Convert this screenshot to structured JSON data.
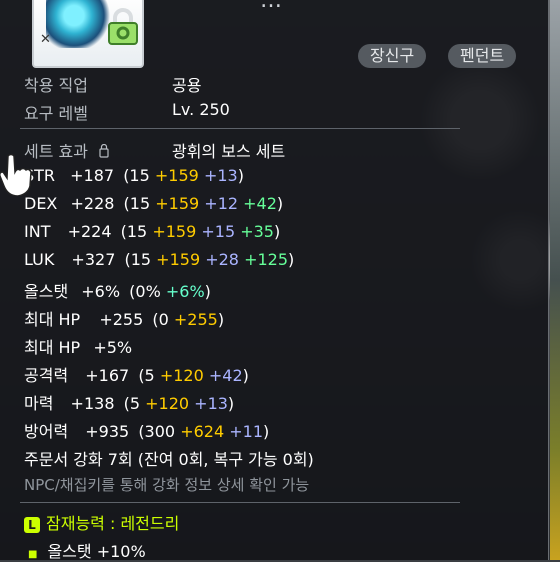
{
  "title": "…",
  "tags": [
    "장신구",
    "펜던트"
  ],
  "job": {
    "label": "착용 직업",
    "value": "공용"
  },
  "level": {
    "label": "요구 레벨",
    "value": "Lv. 250"
  },
  "set_effect": {
    "label": "세트 효과",
    "value": "광휘의 보스 세트"
  },
  "stats": [
    {
      "name": "STR",
      "total": "+187",
      "open": "(15",
      "gold": "+159",
      "purple": "+13",
      "green": "",
      "close": ")"
    },
    {
      "name": "DEX",
      "total": "+228",
      "open": "(15",
      "gold": "+159",
      "purple": "+12",
      "green": "+42",
      "close": ")"
    },
    {
      "name": "INT",
      "total": "+224",
      "open": "(15",
      "gold": "+159",
      "purple": "+15",
      "green": "+35",
      "close": ")"
    },
    {
      "name": "LUK",
      "total": "+327",
      "open": "(15",
      "gold": "+159",
      "purple": "+28",
      "green": "+125",
      "close": ")"
    }
  ],
  "allstat": {
    "name": "올스탯",
    "total": "+6%",
    "open": "(0%",
    "cyan": "+6%",
    "close": ")"
  },
  "maxhp": {
    "name": "최대 HP",
    "total": "+255",
    "open": "(0",
    "gold": "+255",
    "close": ")"
  },
  "maxhp_pct": {
    "name": "최대 HP",
    "total": "+5%"
  },
  "attack": {
    "name": "공격력",
    "total": "+167",
    "open": "(5",
    "gold": "+120",
    "purple": "+42",
    "close": ")"
  },
  "magic": {
    "name": "마력",
    "total": "+138",
    "open": "(5",
    "gold": "+120",
    "purple": "+13",
    "close": ")"
  },
  "defense": {
    "name": "방어력",
    "total": "+935",
    "open": "(300",
    "gold": "+624",
    "purple": "+11",
    "close": ")"
  },
  "scroll_text": "주문서 강화 7회 (잔여 0회, 복구 가능 0회)",
  "npc_text": "NPC/채집키를 통해 강화 정보 상세 확인 가능",
  "potential": {
    "badge": "L",
    "label": "잠재능력 : 레전드리",
    "line1": "올스탯 +10%"
  },
  "colors": {
    "gold": "#ffcc00",
    "purple": "#aab4ff",
    "green": "#66ff99",
    "cyan": "#66ffcc",
    "potential": "#ccff00"
  }
}
